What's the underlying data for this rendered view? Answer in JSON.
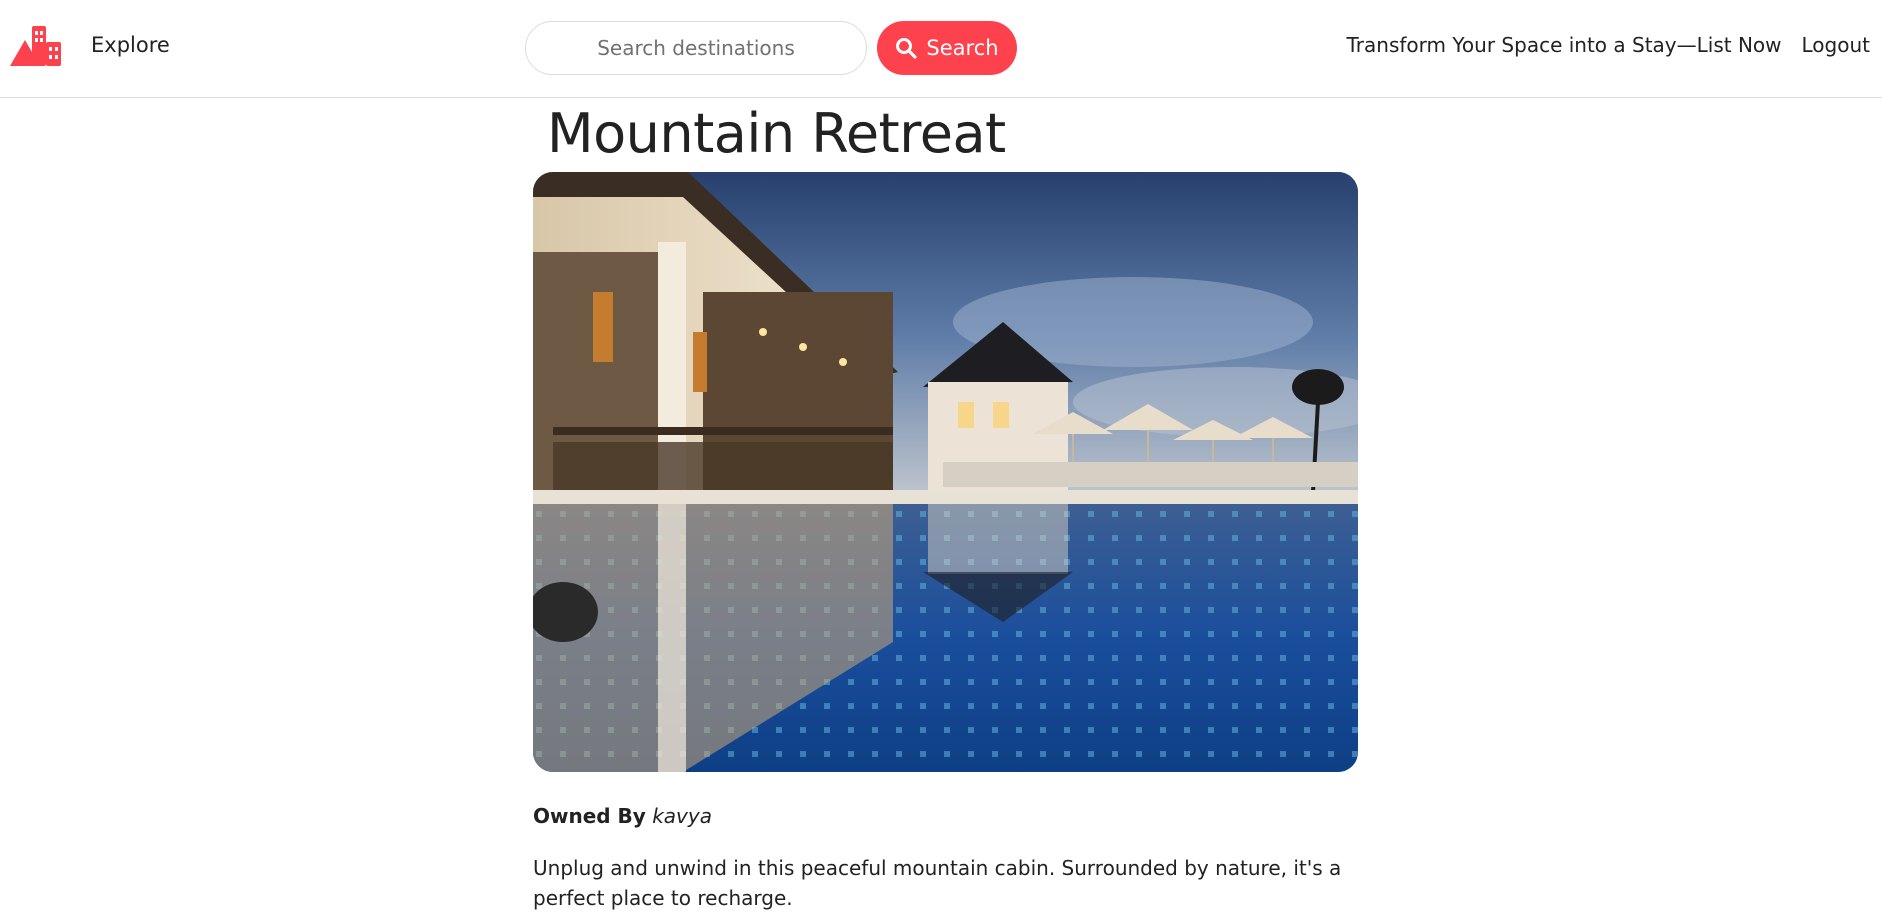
{
  "navbar": {
    "logo_icon": "hotel-building-icon",
    "explore_label": "Explore",
    "search": {
      "placeholder": "Search destinations",
      "value": "",
      "button_label": "Search",
      "button_icon": "magnifying-glass-icon"
    },
    "list_property_label": "Transform Your Space into a Stay—List Now",
    "logout_label": "Logout"
  },
  "listing": {
    "title": "Mountain Retreat",
    "image_alt": "resort-pool-photo",
    "owner_label": "Owned By",
    "owner_name": "kavya",
    "description": "Unplug and unwind in this peaceful mountain cabin. Surrounded by nature, it's a perfect place to recharge."
  },
  "colors": {
    "brand": "#fe424d",
    "text": "#222222",
    "border": "#dddddd",
    "placeholder": "#717171"
  }
}
